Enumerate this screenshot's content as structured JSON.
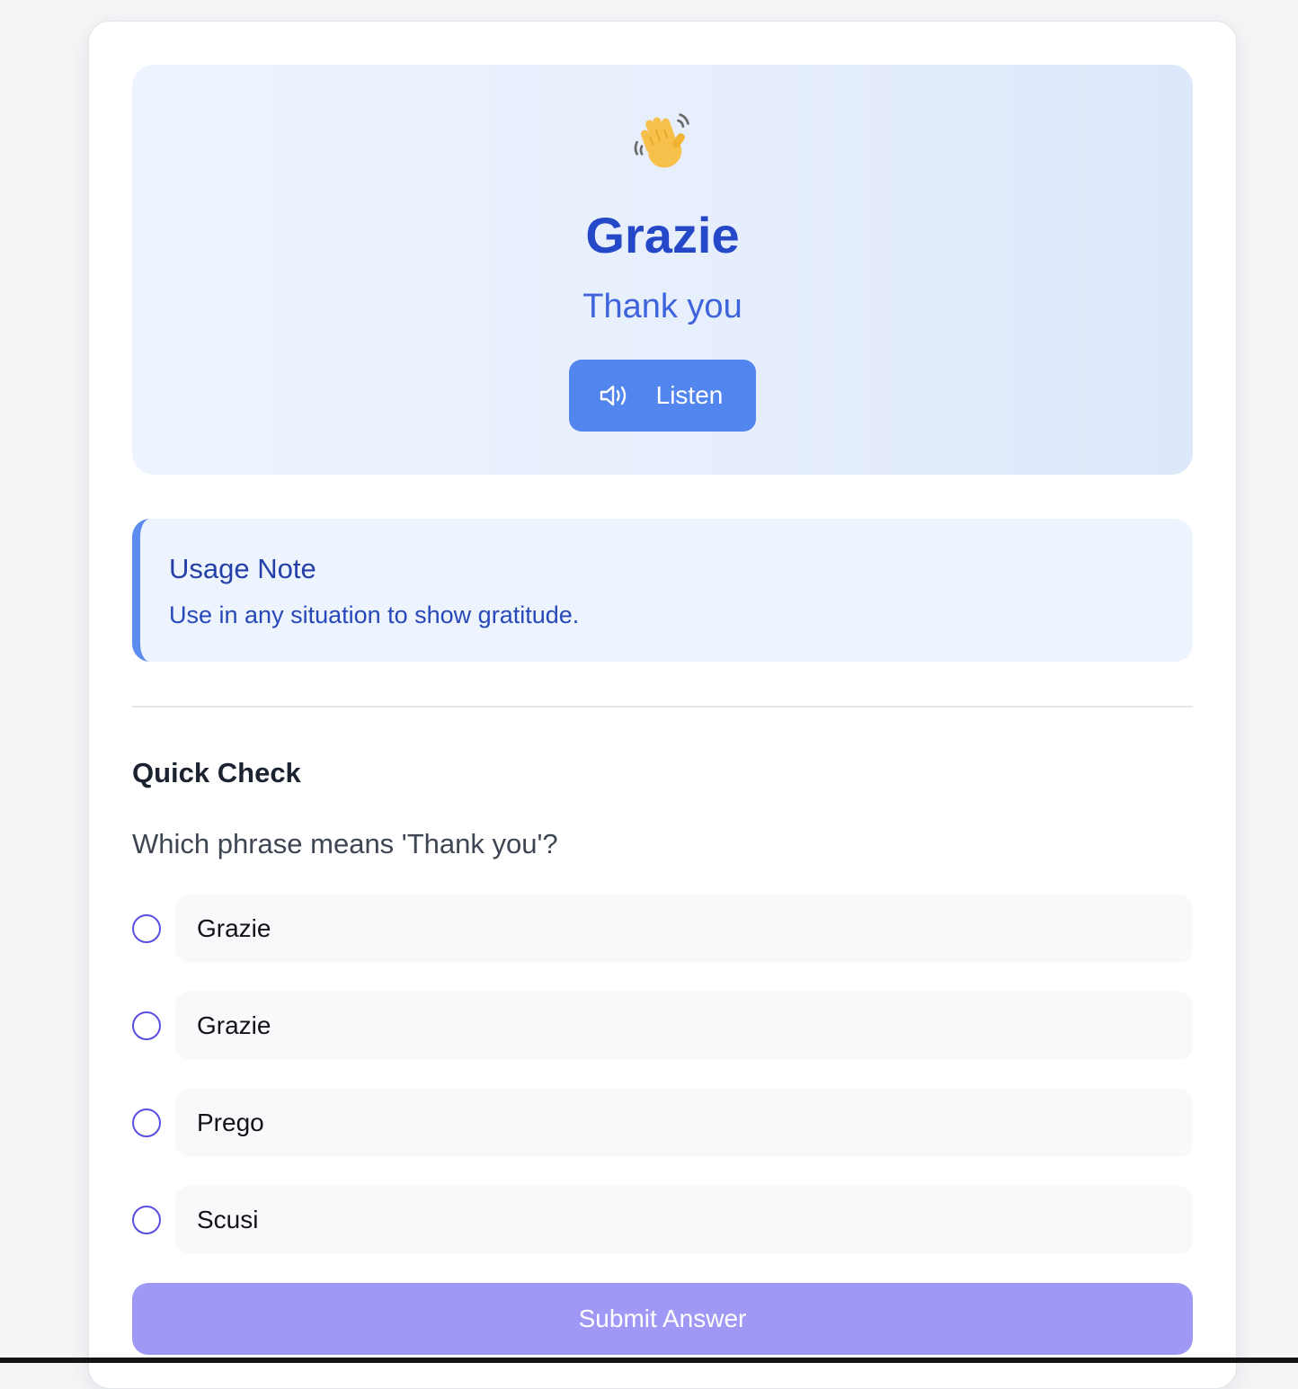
{
  "lesson": {
    "emoji_icon": "waving-hand-icon",
    "phrase": "Grazie",
    "translation": "Thank you",
    "listen_label": "Listen",
    "listen_icon": "speaker-icon"
  },
  "usage_note": {
    "title": "Usage Note",
    "text": "Use in any situation to show gratitude."
  },
  "quiz": {
    "title": "Quick Check",
    "question": "Which phrase means 'Thank you'?",
    "options": [
      {
        "label": "Grazie",
        "selected": false
      },
      {
        "label": "Grazie",
        "selected": false
      },
      {
        "label": "Prego",
        "selected": false
      },
      {
        "label": "Scusi",
        "selected": false
      }
    ],
    "submit_label": "Submit Answer"
  },
  "colors": {
    "accent": "#2548c9",
    "listen_button": "#5285ee",
    "note_border": "#5d8cf0",
    "radio": "#5a4ee0",
    "submit_button": "#9f98f4"
  }
}
